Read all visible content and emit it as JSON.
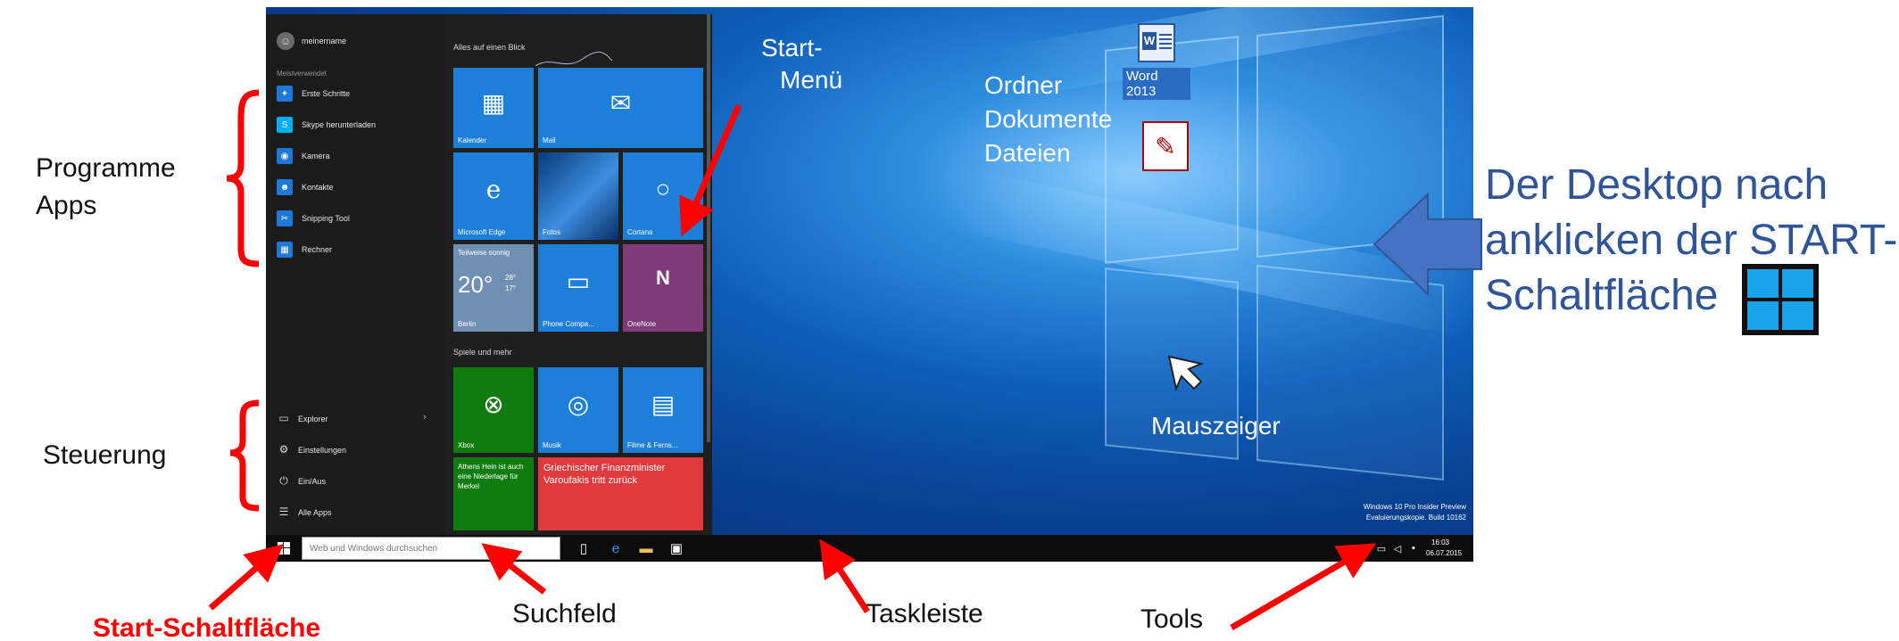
{
  "annotations": {
    "programme_apps": [
      "Programme",
      "Apps"
    ],
    "steuerung": "Steuerung",
    "start_menu": [
      "Start-",
      "Menü"
    ],
    "ordner": [
      "Ordner",
      "Dokumente",
      "Dateien"
    ],
    "desktop_caption": [
      "Der Desktop nach",
      "anklicken der START-",
      "Schaltfläche"
    ],
    "mauszeiger": "Mauszeiger",
    "start_schaltflaeche": "Start-Schaltfläche",
    "suchfeld": "Suchfeld",
    "taskleiste": "Taskleiste",
    "tools": "Tools"
  },
  "colors": {
    "annotation_red": "#ff0000",
    "caption_blue": "#2f5597",
    "arrow_blue": "#4472c4",
    "tile_blue": "#1d7fd8",
    "tile_green": "#107c10",
    "tile_purple": "#80397b",
    "tile_red": "#e0393e"
  },
  "start_menu": {
    "user_name": "meinername",
    "most_used_header": "Meistverwendet",
    "apps": [
      {
        "label": "Erste Schritte",
        "icon": "lightbulb-icon"
      },
      {
        "label": "Skype herunterladen",
        "icon": "skype-icon"
      },
      {
        "label": "Kamera",
        "icon": "camera-icon"
      },
      {
        "label": "Kontakte",
        "icon": "contacts-icon"
      },
      {
        "label": "Snipping Tool",
        "icon": "scissors-icon"
      },
      {
        "label": "Rechner",
        "icon": "calculator-icon"
      }
    ],
    "controls": [
      {
        "label": "Explorer",
        "icon": "folder-icon"
      },
      {
        "label": "Einstellungen",
        "icon": "gear-icon"
      },
      {
        "label": "Ein/Aus",
        "icon": "power-icon"
      },
      {
        "label": "Alle Apps",
        "icon": "list-icon"
      }
    ],
    "group1_header": "Alles auf einen Blick",
    "group2_header": "Spiele und mehr",
    "tiles": {
      "kalender": "Kalender",
      "mail": "Mail",
      "edge": "Microsoft Edge",
      "fotos": "Fotos",
      "cortana": "Cortana",
      "weather_title": "Teilweise sonnig",
      "weather_temp": "20°",
      "weather_hi": "28°",
      "weather_lo": "17°",
      "weather_city": "Berlin",
      "phone": "Phone Compa...",
      "onenote": "OneNote",
      "xbox": "Xbox",
      "musik": "Musik",
      "filme": "Filme & Ferns...",
      "news_green": "Athens Hein ist auch eine Niederlage für Merkel",
      "news_red": "Griechischer Finanzminister Varoufakis tritt zurück"
    }
  },
  "taskbar": {
    "search_placeholder": "Web und Windows durchsuchen",
    "clock_time": "16:03",
    "clock_date": "06.07.2015"
  },
  "desktop": {
    "word_label": "Word 2013",
    "watermark_line1": "Windows 10 Pro Insider Preview",
    "watermark_line2": "Evaluierungskopie. Build 10162"
  }
}
